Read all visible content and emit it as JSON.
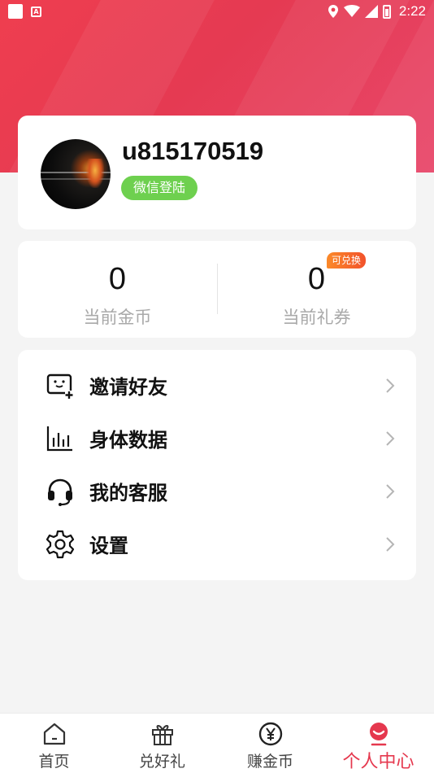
{
  "status_bar": {
    "time": "2:22"
  },
  "profile": {
    "username": "u815170519",
    "login_method": "微信登陆"
  },
  "stats": {
    "coins": {
      "value": "0",
      "label": "当前金币"
    },
    "coupons": {
      "value": "0",
      "label": "当前礼券",
      "badge": "可兑换"
    }
  },
  "menu": [
    {
      "label": "邀请好友",
      "icon": "invite-icon"
    },
    {
      "label": "身体数据",
      "icon": "chart-icon"
    },
    {
      "label": "我的客服",
      "icon": "headset-icon"
    },
    {
      "label": "设置",
      "icon": "gear-icon"
    }
  ],
  "tabs": [
    {
      "label": "首页",
      "icon": "home-icon"
    },
    {
      "label": "兑好礼",
      "icon": "gift-icon"
    },
    {
      "label": "赚金币",
      "icon": "yen-coin-icon"
    },
    {
      "label": "个人中心",
      "icon": "profile-icon",
      "active": true
    }
  ],
  "colors": {
    "accent": "#e5384e",
    "login_badge": "#6ed04f",
    "redeem_badge": "#f46a2b"
  }
}
